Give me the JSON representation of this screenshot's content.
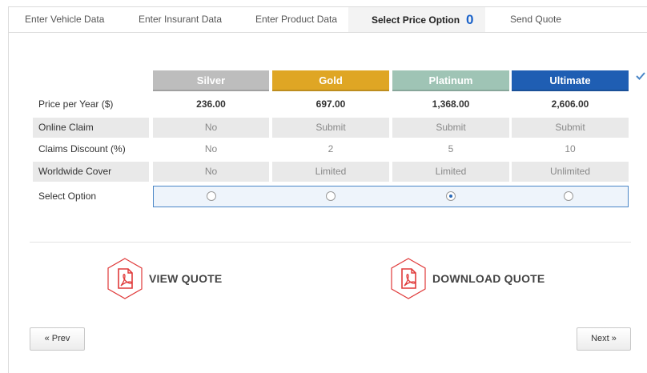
{
  "tabs": [
    {
      "label": "Enter Vehicle Data"
    },
    {
      "label": "Enter Insurant Data"
    },
    {
      "label": "Enter Product Data"
    },
    {
      "label": "Select Price Option",
      "count": "0",
      "active": true
    },
    {
      "label": "Send Quote"
    }
  ],
  "plans": [
    {
      "name": "Silver",
      "color": "#bdbdbd",
      "price": "236.00",
      "online_claim": "No",
      "claims_discount": "No",
      "worldwide_cover": "No",
      "selected": false
    },
    {
      "name": "Gold",
      "color": "#dfa624",
      "price": "697.00",
      "online_claim": "Submit",
      "claims_discount": "2",
      "worldwide_cover": "Limited",
      "selected": false
    },
    {
      "name": "Platinum",
      "color": "#9fc4b5",
      "price": "1,368.00",
      "online_claim": "Submit",
      "claims_discount": "5",
      "worldwide_cover": "Limited",
      "selected": true
    },
    {
      "name": "Ultimate",
      "color": "#1f5eb3",
      "price": "2,606.00",
      "online_claim": "Submit",
      "claims_discount": "10",
      "worldwide_cover": "Unlimited",
      "selected": false
    }
  ],
  "rows": {
    "price": "Price per Year ($)",
    "online_claim": "Online Claim",
    "claims_discount": "Claims Discount (%)",
    "worldwide_cover": "Worldwide Cover",
    "select_option": "Select Option"
  },
  "actions": {
    "view_quote": "VIEW QUOTE",
    "download_quote": "DOWNLOAD QUOTE",
    "prev": "« Prev",
    "next": "Next »"
  },
  "icons": {
    "completed": "check-icon",
    "pdf": "pdf-icon"
  },
  "colors": {
    "accent": "#1a62c9",
    "pdf_red": "#e03a3a",
    "select_border": "#4a86c7"
  }
}
